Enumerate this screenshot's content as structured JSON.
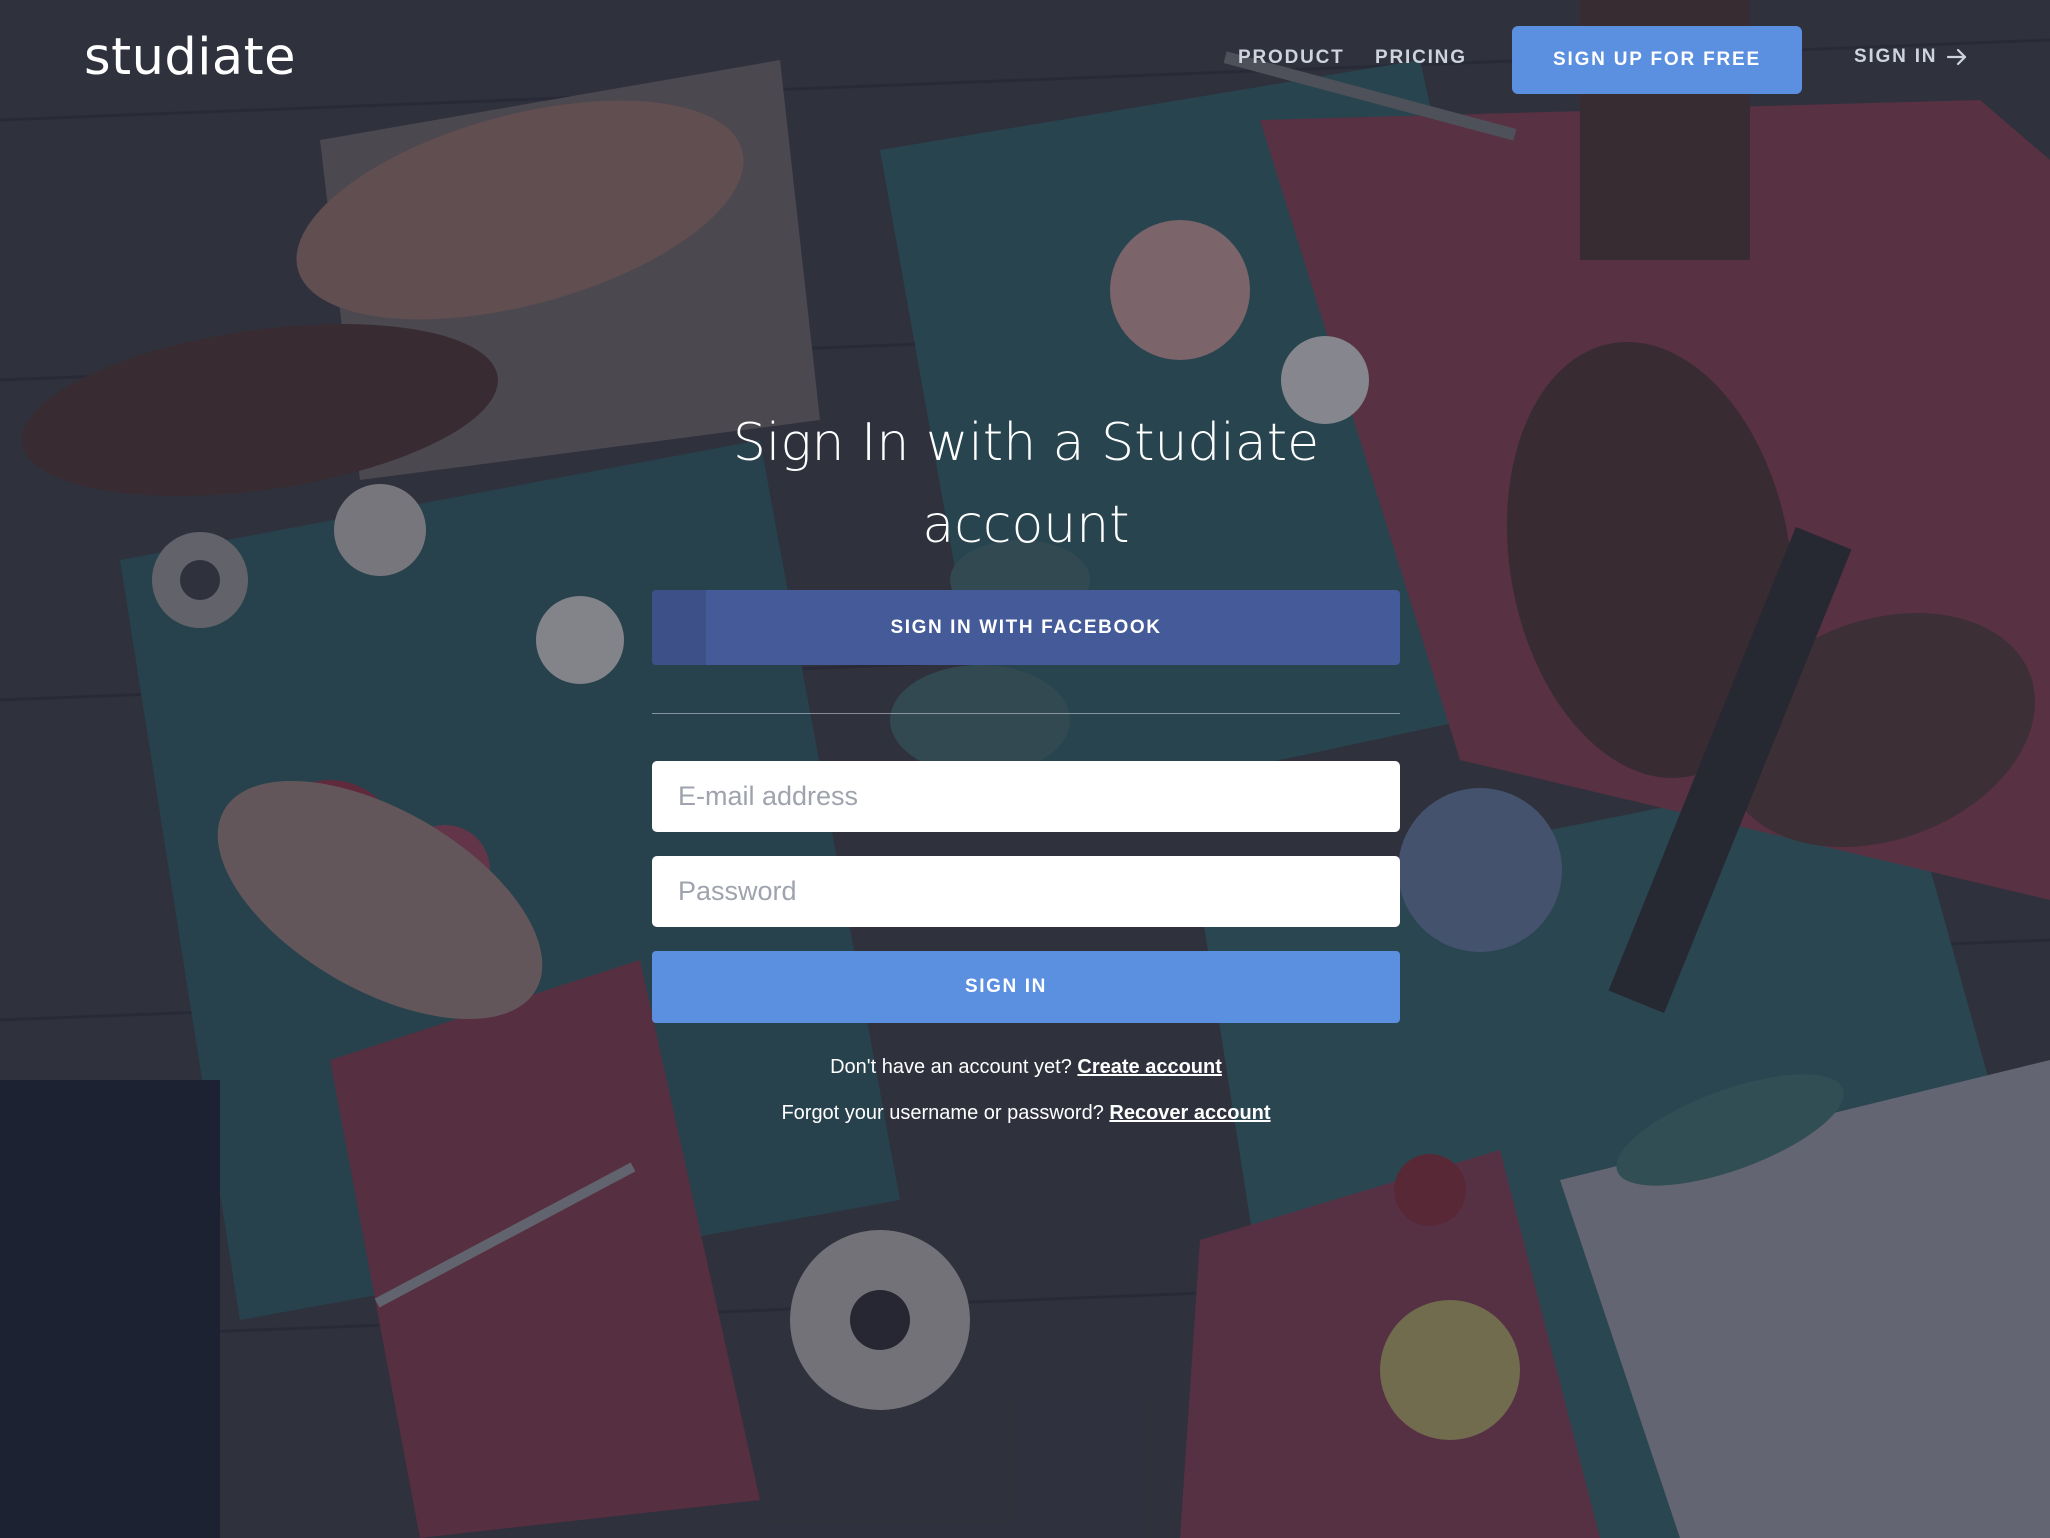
{
  "header": {
    "logo": "studiate",
    "nav": {
      "product": "PRODUCT",
      "pricing": "PRICING"
    },
    "signup_button": "SIGN UP FOR FREE",
    "signin_link": "SIGN IN",
    "signin_icon": "arrow-right-icon"
  },
  "form": {
    "title": "Sign In with a Studiate account",
    "facebook_button": "SIGN IN WITH FACEBOOK",
    "email_placeholder": "E-mail address",
    "password_placeholder": "Password",
    "signin_button": "SIGN IN",
    "no_account_text": "Don't have an account yet?",
    "create_account_link": "Create account",
    "forgot_text": "Forgot your username or password?",
    "recover_account_link": "Recover account"
  },
  "colors": {
    "accent": "#5b8fe0",
    "facebook": "#455a98",
    "overlay": "#1e2238"
  }
}
